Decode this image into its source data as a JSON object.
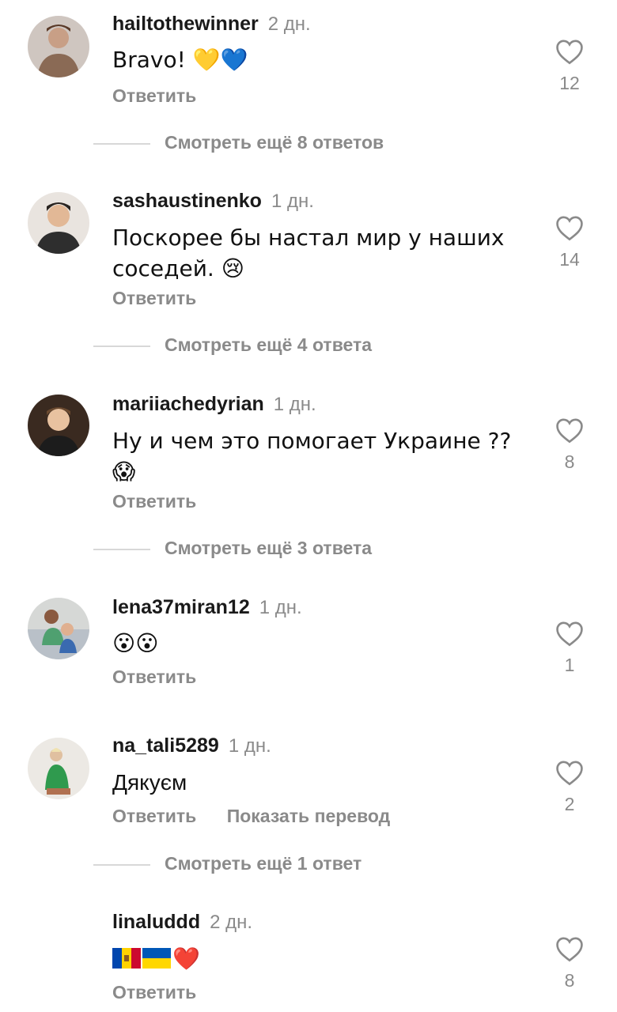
{
  "colors": {
    "meta_gray": "#8a8a8a",
    "divider": "#d8d8d8",
    "text": "#111111"
  },
  "reply_label": "Ответить",
  "comments": [
    {
      "username": "hailtothewinner",
      "time": "2 дн.",
      "text": "Bravo! 💛💙",
      "likes": "12",
      "more_replies": "Смотреть ещё 8 ответов"
    },
    {
      "username": "sashaustinenko",
      "time": "1 дн.",
      "text": "Поскорее бы настал мир у наших соседей. 😢",
      "likes": "14",
      "more_replies": "Смотреть ещё 4 ответа"
    },
    {
      "username": "mariiachedyrian",
      "time": "1 дн.",
      "text": "Ну и чем это помогает Украине ?? 😱",
      "likes": "8",
      "more_replies": "Смотреть ещё 3 ответа"
    },
    {
      "username": "lena37miran12",
      "time": "1 дн.",
      "text": "😮😮",
      "likes": "1"
    },
    {
      "username": "na_tali5289",
      "time": "1 дн.",
      "text": "Дякуєм",
      "likes": "2",
      "translate_label": "Показать перевод",
      "more_replies": "Смотреть ещё 1 ответ"
    },
    {
      "username": "linaluddd",
      "time": "2 дн.",
      "text": "❤️",
      "likes": "8"
    }
  ]
}
